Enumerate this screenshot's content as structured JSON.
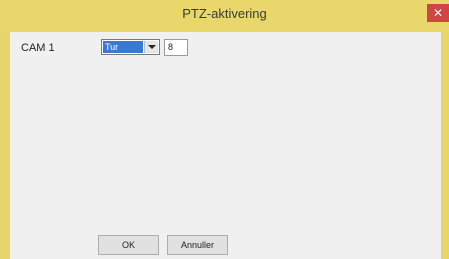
{
  "window": {
    "title": "PTZ-aktivering",
    "close_label": "✕"
  },
  "row": {
    "label": "CAM 1",
    "select_value": "Tur",
    "input_value": "8"
  },
  "buttons": {
    "ok_label": "OK",
    "cancel_label": "Annuller"
  }
}
